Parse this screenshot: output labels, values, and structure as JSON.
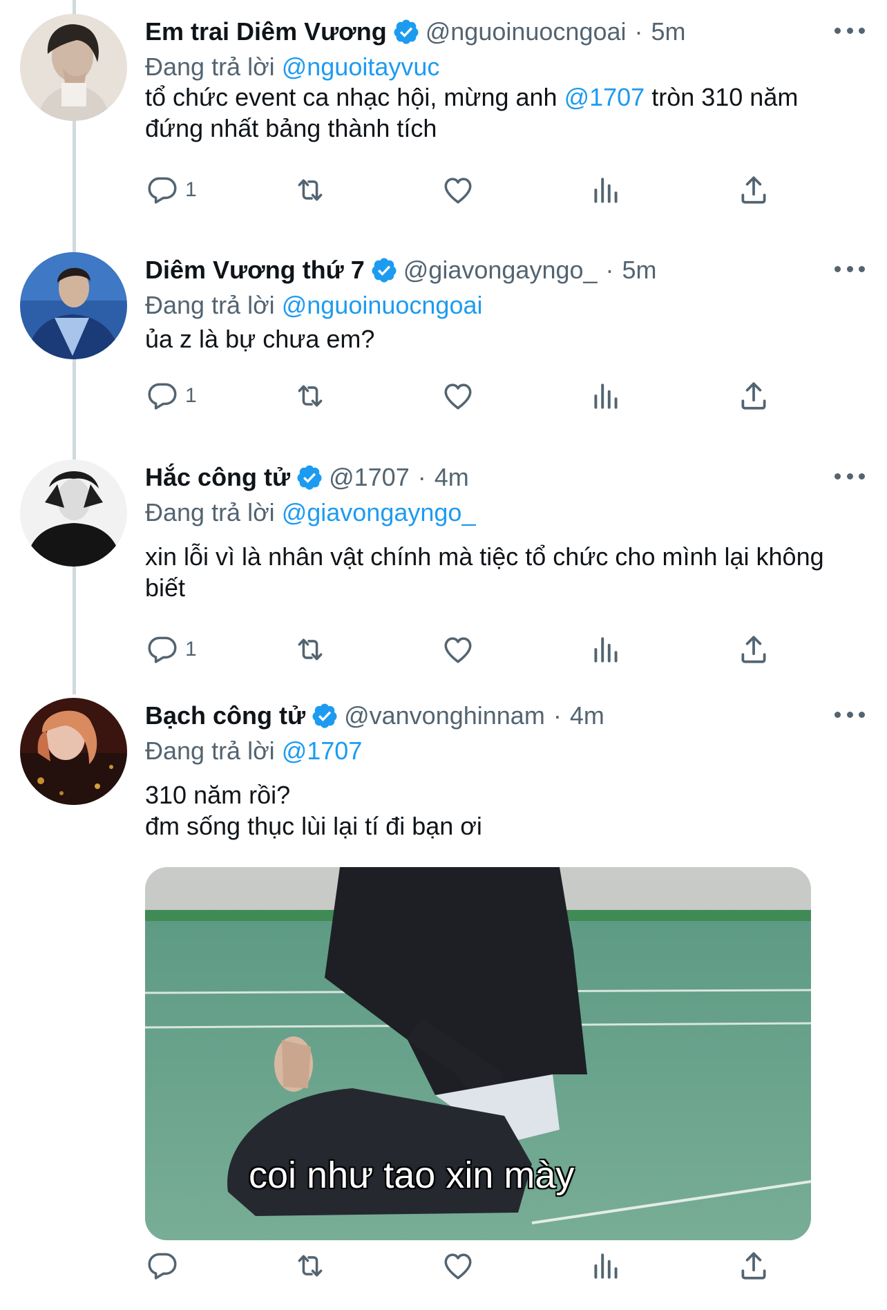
{
  "colors": {
    "accent": "#1d9bf0",
    "secondary_text": "#536471",
    "primary_text": "#0f1419"
  },
  "tweets": [
    {
      "name": "Em trai Diêm Vương",
      "handle": "@nguoinuocngoai",
      "time": "5m",
      "reply_label": "Đang trả lời",
      "reply_handle": "@nguoitayvuc",
      "text_before": "tổ chức event ca nhạc hội, mừng anh ",
      "text_mention": "@1707",
      "text_after": " tròn 310 năm đứng nhất bảng thành tích",
      "reply_count": "1"
    },
    {
      "name": "Diêm Vương thứ 7",
      "handle": "@giavongayngo_",
      "time": "5m",
      "reply_label": "Đang trả lời",
      "reply_handle": "@nguoinuocngoai",
      "text": "ủa z là bự chưa em?",
      "reply_count": "1"
    },
    {
      "name": "Hắc công tử",
      "handle": "@1707",
      "time": "4m",
      "reply_label": "Đang trả lời",
      "reply_handle": "@giavongayngo_",
      "text": "xin lỗi vì là nhân vật chính mà tiệc tổ chức cho mình lại không biết",
      "reply_count": "1"
    },
    {
      "name": "Bạch công tử",
      "handle": "@vanvonghinnam",
      "time": "4m",
      "reply_label": "Đang trả lời",
      "reply_handle": "@1707",
      "text_line1": "310 năm rồi?",
      "text_line2": "đm sống thục lùi lại tí đi bạn ơi",
      "media_caption": "coi như tao xin mày",
      "reply_count": ""
    }
  ],
  "icons": {
    "verified": "verified-badge-icon",
    "more": "more-dots-icon",
    "reply": "reply-bubble-icon",
    "retweet": "retweet-icon",
    "like": "heart-icon",
    "analytics": "analytics-bars-icon",
    "share": "share-upload-icon"
  }
}
